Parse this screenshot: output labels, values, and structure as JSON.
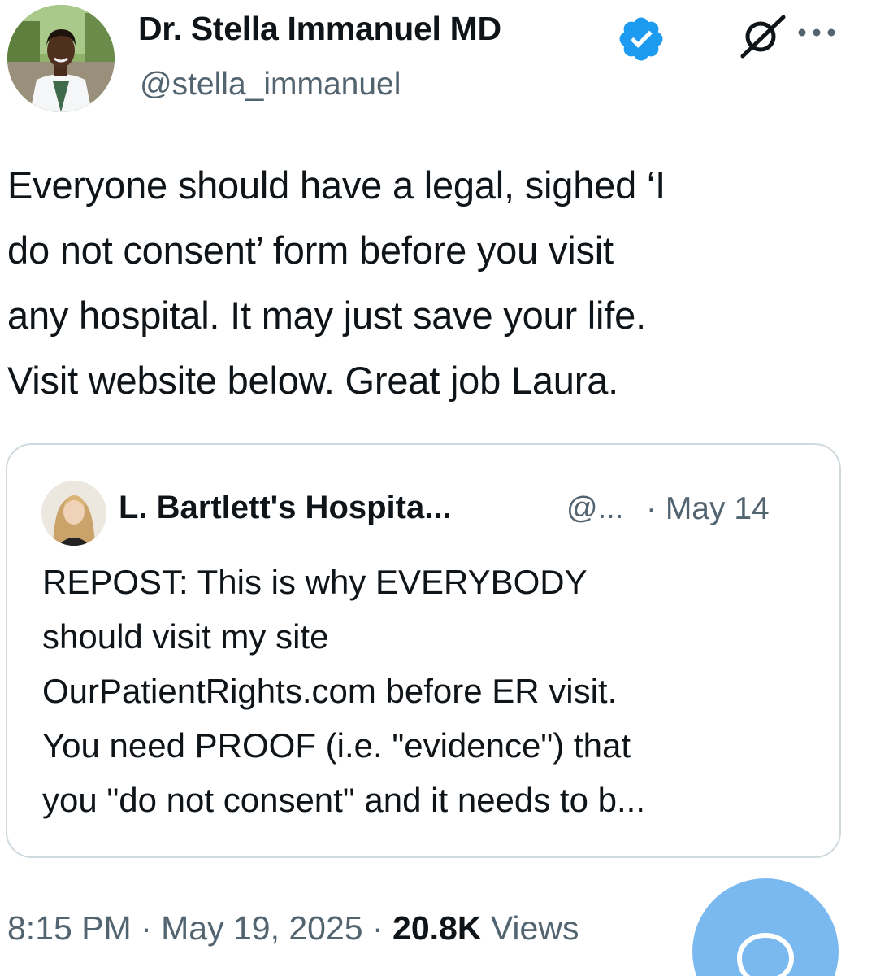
{
  "author": {
    "name": "Dr. Stella Immanuel MD",
    "handle": "@stella_immanuel",
    "verified": true
  },
  "tweet": {
    "lines": [
      "Everyone should have a legal, sighed ‘I",
      "do not consent’ form before you visit",
      "any hospital. It may just save your life.",
      "Visit website below. Great job Laura."
    ]
  },
  "quote": {
    "name": "L. Bartlett's Hospita...",
    "handle": "@...",
    "date": "· May 14",
    "lines": [
      "REPOST: This is why EVERYBODY",
      "should visit my site",
      "OurPatientRights.com before ER visit.",
      "You need PROOF (i.e. \"evidence\") that",
      "you \"do not consent\" and it needs to b..."
    ]
  },
  "meta": {
    "time": "8:15 PM · May 19, 2025 · ",
    "views_count": "20.8K",
    "views_label": " Views"
  },
  "colors": {
    "verified_blue": "#1d9bf0",
    "fab_blue": "#7ab8f0",
    "secondary_text": "#536471"
  },
  "icons": {
    "verified": "verified-badge-icon",
    "grok": "grok-icon",
    "more": "more-dots-icon",
    "reply": "reply-bubble-icon"
  }
}
